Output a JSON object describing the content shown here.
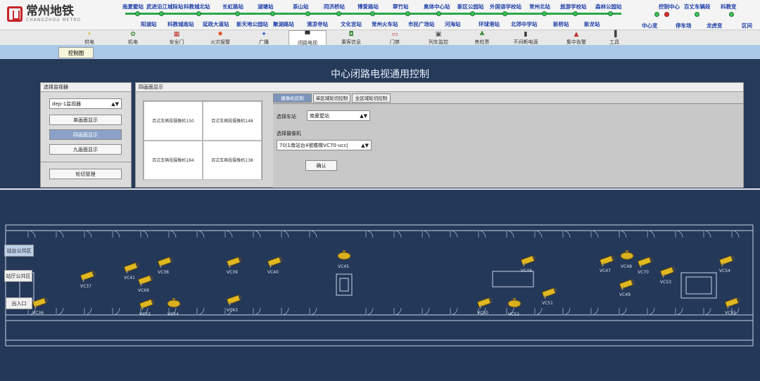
{
  "logo": {
    "name": "常州地铁",
    "sub": "CHANGZHOU METRO"
  },
  "stations_top": [
    "南夏墅站",
    "武进沿江城际站",
    "科教城北站",
    "长虹路站",
    "湖塘站",
    "茶山站",
    "同济桥站",
    "博爱路站",
    "翠竹站",
    "奥体中心站",
    "新区公园站",
    "外国语学校站",
    "常州北站",
    "旅游学校站",
    "森林公园站"
  ],
  "stations_bottom": [
    "阳湖站",
    "科教城南站",
    "延政大道站",
    "新天地公园站",
    "聚湖路站",
    "清凉寺站",
    "文化宫站",
    "常州火车站",
    "市民广场站",
    "河海站",
    "环球港站",
    "北郊中学站",
    "新桥站",
    "新龙站"
  ],
  "right_nav": {
    "top": [
      "控制中心",
      "百丈车辆段",
      "科教变"
    ],
    "bottom": [
      "中心变",
      "停车场",
      "龙虎变",
      "区间"
    ]
  },
  "menu": [
    "供电",
    "机电",
    "安全门",
    "火灾报警",
    "广播",
    "闭路电视",
    "乘客信息",
    "门禁",
    "列车监控",
    "售检票",
    "不间断电源",
    "集中告警",
    "工具"
  ],
  "ctrl_tab": "控制图",
  "page_title": "中心闭路电视通用控制",
  "left_panel": {
    "title": "选择监视器",
    "monitor": "dep-1监视器",
    "buttons": [
      "单画面显示",
      "四画面显示",
      "九画面显示"
    ],
    "manage": "轮切管理"
  },
  "four_panel": {
    "title": "四画面显示",
    "cells": [
      "百式车辆段摄像机150",
      "百式车辆段摄像机148",
      "百式车辆段摄像机184",
      "百式车辆段摄像机138"
    ]
  },
  "right_tabs": [
    "摄像机控制",
    "单区域轮切控制",
    "全区域轮切控制"
  ],
  "station_label": "选择车站",
  "station_value": "南夏墅站",
  "camera_label": "选择摄像机",
  "camera_value": "70|1南站台4號楼梯VC70-ucc|",
  "confirm": "确认",
  "zones": [
    "站台公共区",
    "站厅公共区",
    "出入口"
  ],
  "cameras": [
    {
      "id": "VC37"
    },
    {
      "id": "VC41"
    },
    {
      "id": "VC38"
    },
    {
      "id": "VC39"
    },
    {
      "id": "VC40"
    },
    {
      "id": "VC45"
    },
    {
      "id": "VC69"
    },
    {
      "id": "VC36"
    },
    {
      "id": "VC42"
    },
    {
      "id": "VC44"
    },
    {
      "id": "VC43"
    },
    {
      "id": "VC46"
    },
    {
      "id": "VC50"
    },
    {
      "id": "VC52"
    },
    {
      "id": "VC51"
    },
    {
      "id": "VC47"
    },
    {
      "id": "VC48"
    },
    {
      "id": "VC70"
    },
    {
      "id": "VC53"
    },
    {
      "id": "VC49"
    },
    {
      "id": "VC54"
    },
    {
      "id": "VC55"
    }
  ]
}
